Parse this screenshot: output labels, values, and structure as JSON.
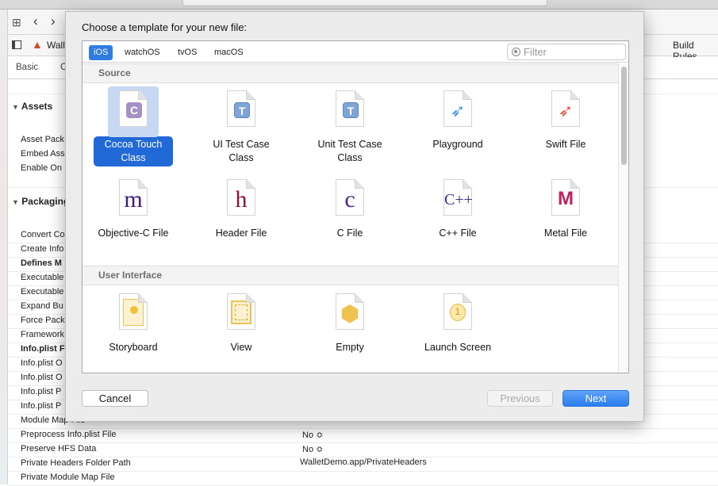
{
  "window": {
    "breadcrumb_project": "Walle",
    "tabs": [
      "Basic",
      "C"
    ],
    "right_tab": "Build Rules"
  },
  "settings": {
    "sections": [
      {
        "label": "Assets",
        "items": [
          "Asset Pack",
          "Embed Ass",
          "Enable On"
        ]
      },
      {
        "label": "Packaging",
        "items": [
          "Convert Co",
          "Create Info",
          "Defines M",
          "Executable",
          "Executable",
          "Expand Bu",
          "Force Pack",
          "Framework",
          "Info.plist F",
          "Info.plist O",
          "Info.plist O",
          "Info.plist P",
          "Info.plist P",
          "Module Map File",
          "Preprocess Info.plist File",
          "Preserve HFS Data",
          "Private Headers Folder Path",
          "Private Module Map File"
        ]
      }
    ],
    "values": {
      "preprocess": "No ≎",
      "preserve": "No ≎",
      "private_headers": "WalletDemo.app/PrivateHeaders"
    }
  },
  "dialog": {
    "title": "Choose a template for your new file:",
    "platform_tabs": [
      {
        "label": "iOS",
        "selected": true
      },
      {
        "label": "watchOS"
      },
      {
        "label": "tvOS"
      },
      {
        "label": "macOS"
      }
    ],
    "filter_placeholder": "Filter",
    "sections": [
      {
        "label": "Source",
        "items": [
          {
            "label": "Cocoa Touch Class",
            "icon": "cocoa-touch-class-icon",
            "glyph": "C",
            "selected": true
          },
          {
            "label": "UI Test Case Class",
            "icon": "ui-test-case-icon",
            "glyph": "T"
          },
          {
            "label": "Unit Test Case Class",
            "icon": "unit-test-case-icon",
            "glyph": "T"
          },
          {
            "label": "Playground",
            "icon": "playground-swift-icon",
            "glyph": "🕊"
          },
          {
            "label": "Swift File",
            "icon": "swift-file-icon",
            "glyph": "🕊"
          },
          {
            "label": "Objective-C File",
            "icon": "objc-file-icon",
            "glyph": "m"
          },
          {
            "label": "Header File",
            "icon": "header-file-icon",
            "glyph": "h"
          },
          {
            "label": "C File",
            "icon": "c-file-icon",
            "glyph": "c"
          },
          {
            "label": "C++ File",
            "icon": "cpp-file-icon",
            "glyph": "C++"
          },
          {
            "label": "Metal File",
            "icon": "metal-file-icon",
            "glyph": "M"
          }
        ]
      },
      {
        "label": "User Interface",
        "items": [
          {
            "label": "Storyboard",
            "icon": "storyboard-icon"
          },
          {
            "label": "View",
            "icon": "view-icon"
          },
          {
            "label": "Empty",
            "icon": "empty-cube-icon"
          },
          {
            "label": "Launch Screen",
            "icon": "launch-screen-icon",
            "glyph": "1"
          }
        ]
      }
    ],
    "buttons": {
      "cancel": "Cancel",
      "previous": "Previous",
      "next": "Next"
    },
    "colors": {
      "accent": "#2f7de1",
      "selection": "#2069d6"
    }
  }
}
